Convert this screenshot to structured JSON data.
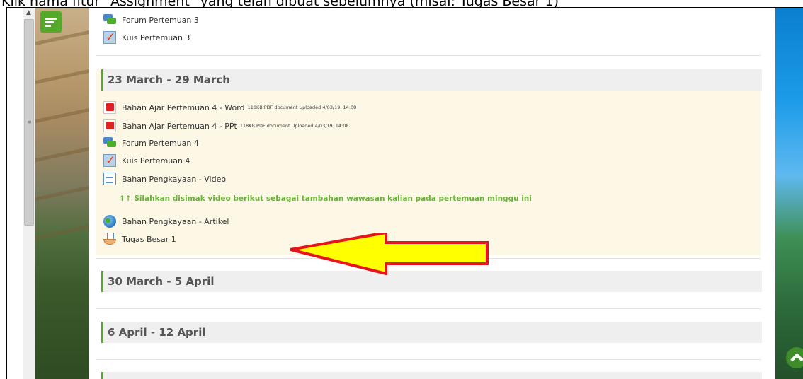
{
  "instruction_caption": "Klik nama fitur \"Assignment\" yang telah dibuat sebelumnya (misal: Tugas Besar 1)",
  "top_items": [
    {
      "label": "Forum Pertemuan 3",
      "icon": "forum-icon"
    },
    {
      "label": "Kuis Pertemuan 3",
      "icon": "quiz-icon"
    }
  ],
  "sections": [
    {
      "title": "23 March - 29 March",
      "current": true,
      "items": [
        {
          "label": "Bahan Ajar Pertemuan 4 - Word",
          "meta": "118KB PDF document Uploaded 4/03/19, 14:08",
          "icon": "pdf-icon"
        },
        {
          "label": "Bahan Ajar Pertemuan 4 - PPt",
          "meta": "118KB PDF document Uploaded 4/03/19, 14:08",
          "icon": "pdf-icon"
        },
        {
          "label": "Forum Pertemuan 4",
          "icon": "forum-icon"
        },
        {
          "label": "Kuis Pertemuan 4",
          "icon": "quiz-icon"
        },
        {
          "label": "Bahan Pengkayaan - Video",
          "icon": "page-icon"
        },
        {
          "label": "Bahan Pengkayaan - Artikel",
          "icon": "url-icon"
        },
        {
          "label": "Tugas Besar 1",
          "icon": "assignment-icon"
        }
      ],
      "note": "↑↑ Silahkan disimak video berikut sebagai tambahan wawasan kalian pada pertemuan minggu ini"
    },
    {
      "title": "30 March - 5 April",
      "current": false
    },
    {
      "title": "6 April - 12 April",
      "current": false
    }
  ],
  "colors": {
    "accent_green": "#55a82a",
    "note_green": "#6ab33a",
    "arrow_fill": "#ffff00",
    "arrow_stroke": "#e8141c",
    "current_section_bg": "#fdf7e6"
  }
}
